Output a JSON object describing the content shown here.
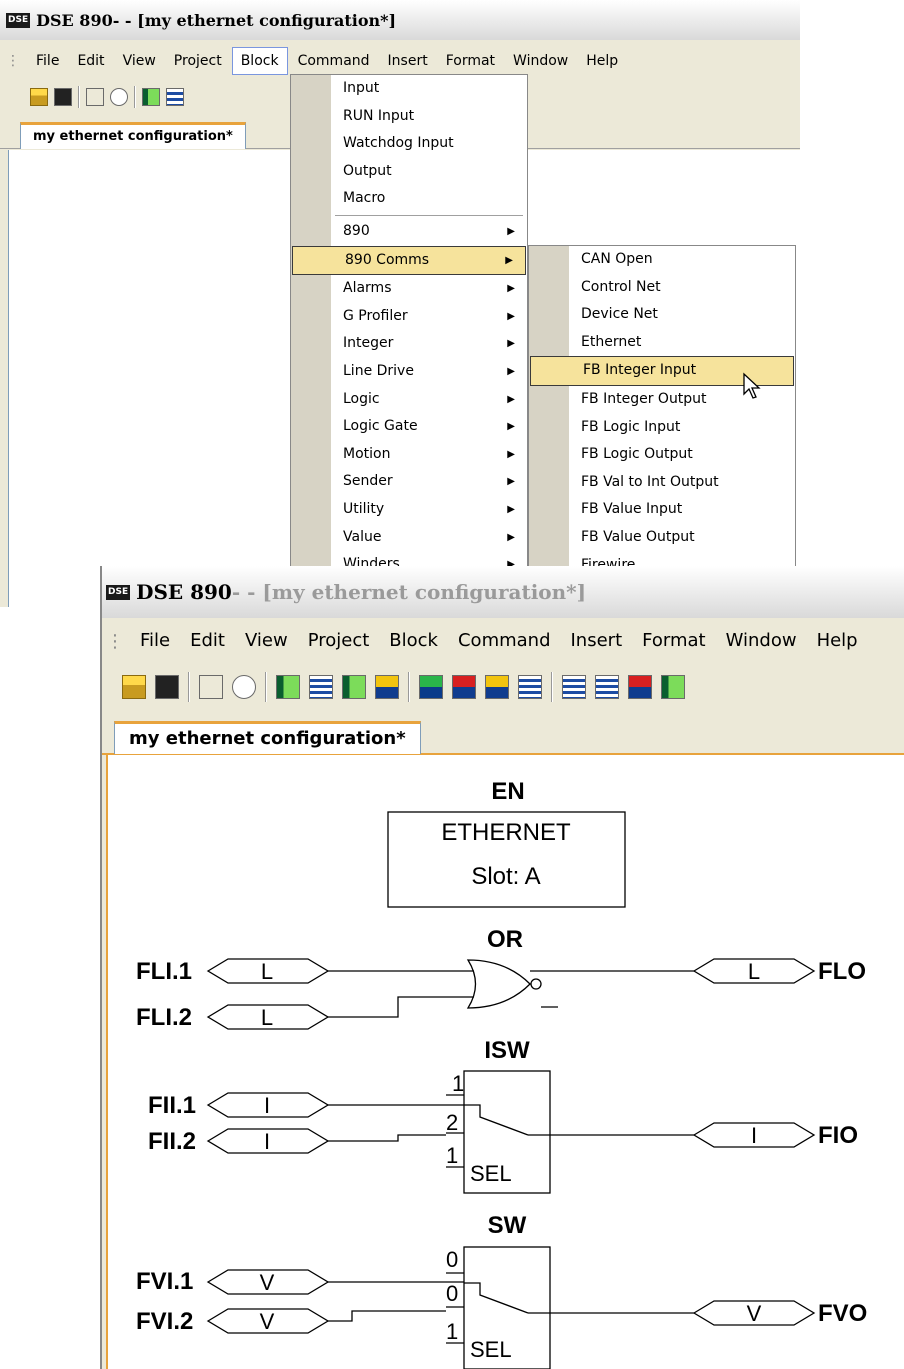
{
  "window1": {
    "logo": "DSE",
    "title_app": "DSE 890",
    "title_rest": " - - [my ethernet configuration*]",
    "menubar": [
      "File",
      "Edit",
      "View",
      "Project",
      "Block",
      "Command",
      "Insert",
      "Format",
      "Window",
      "Help"
    ],
    "tab_label": "my ethernet configuration*",
    "block_menu": {
      "top_items": [
        "Input",
        "RUN Input",
        "Watchdog Input",
        "Output",
        "Macro"
      ],
      "sub_items": [
        "890",
        "890 Comms",
        "Alarms",
        "G Profiler",
        "Integer",
        "Line Drive",
        "Logic",
        "Logic Gate",
        "Motion",
        "Sender",
        "Utility",
        "Value",
        "Winders"
      ],
      "highlighted": "890 Comms"
    },
    "comms_submenu": {
      "items": [
        "CAN Open",
        "Control Net",
        "Device Net",
        "Ethernet",
        "FB Integer Input",
        "FB Integer Output",
        "FB Logic Input",
        "FB Logic Output",
        "FB Val to Int Output",
        "FB Value Input",
        "FB Value Output",
        "Firewire"
      ],
      "highlighted": "FB Integer Input"
    }
  },
  "window2": {
    "logo": "DSE",
    "title_app": "DSE 890",
    "title_rest": " - - [my ethernet configuration*]",
    "menubar": [
      "File",
      "Edit",
      "View",
      "Project",
      "Block",
      "Command",
      "Insert",
      "Format",
      "Window",
      "Help"
    ],
    "tab_label": "my ethernet configuration*",
    "diagram": {
      "en_block": {
        "label": "EN",
        "line1": "ETHERNET",
        "line2": "Slot: A"
      },
      "or_block": {
        "label": "OR",
        "inputs": [
          "FLI.1",
          "FLI.2"
        ],
        "in_tag": "L",
        "output": "FLO",
        "out_tag": "L"
      },
      "isw_block": {
        "label": "ISW",
        "inputs": [
          "FII.1",
          "FII.2"
        ],
        "in_tag": "I",
        "pins": [
          "1",
          "2",
          "1"
        ],
        "sel": "SEL",
        "output": "FIO",
        "out_tag": "I"
      },
      "sw_block": {
        "label": "SW",
        "inputs": [
          "FVI.1",
          "FVI.2"
        ],
        "in_tag": "V",
        "pins": [
          "0",
          "0",
          "1"
        ],
        "sel": "SEL",
        "output": "FVO",
        "out_tag": "V"
      }
    }
  },
  "icons": [
    "open-folder-icon",
    "save-icon",
    "block-icon",
    "zoom-icon",
    "mouse-cursor-icon",
    "submenu-arrow-icon"
  ],
  "colors": {
    "highlight": "#f6e39c",
    "tab_accent": "#e8a33c",
    "menu_strip": "#d7d3c5",
    "window_bg": "#ece9d8"
  }
}
